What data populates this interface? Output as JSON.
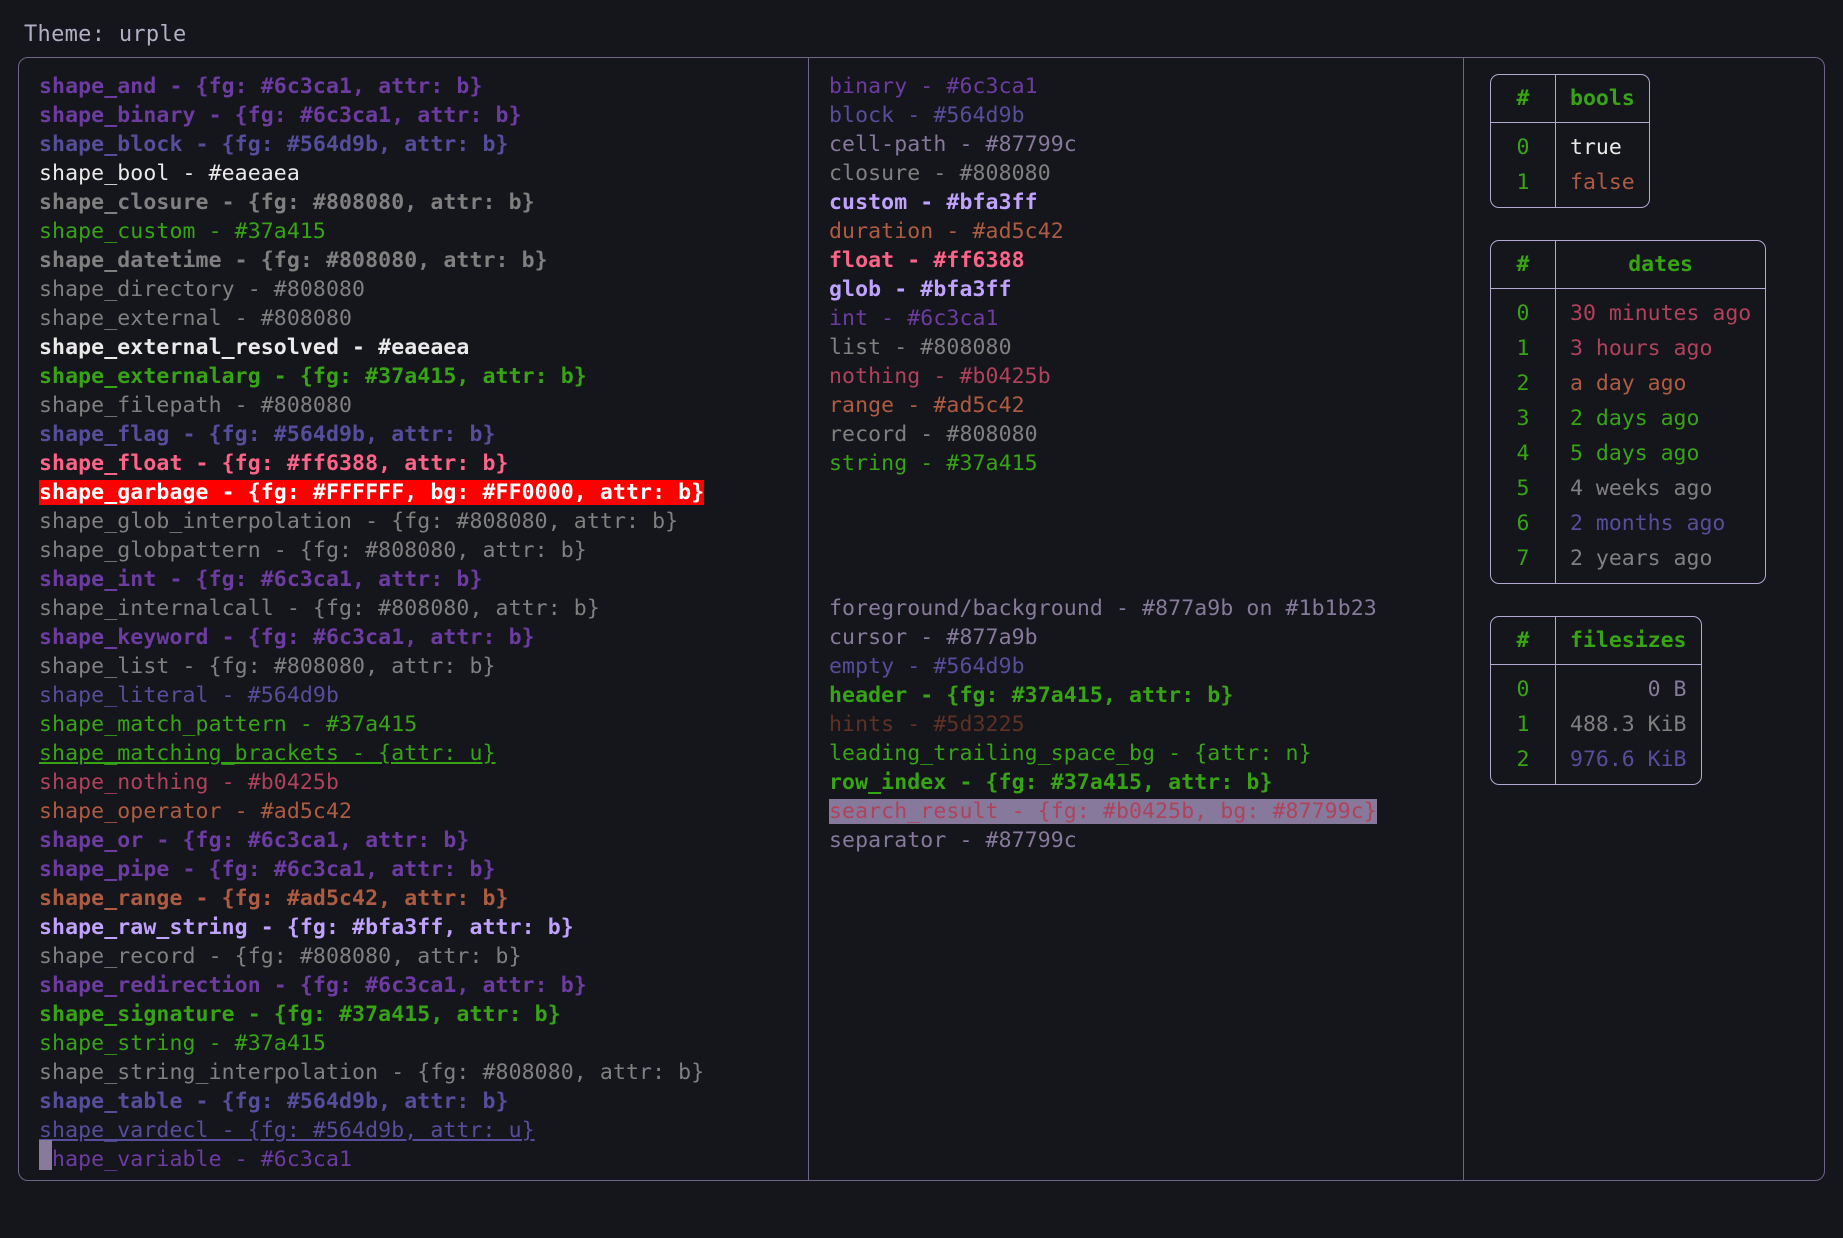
{
  "title": "Theme: urple",
  "palette": {
    "bg": "#15151c",
    "fg": "#877a9b",
    "purple": "#6c3ca1",
    "indigo": "#564d9b",
    "white": "#eaeaea",
    "gray": "#808080",
    "green": "#37a415",
    "pink": "#ff6388",
    "crimson": "#b0425b",
    "orange": "#ad5c42",
    "lavender": "#bfa3ff",
    "slate": "#87799c",
    "brown": "#5d3225",
    "red_bg": "#FF0000",
    "white_fg": "#FFFFFF",
    "border": "#6f6388",
    "table_border": "#b3a8d0"
  },
  "shapes": [
    {
      "text": "shape_and - {fg: #6c3ca1, attr: b}",
      "color": "#6c3ca1",
      "bold": true,
      "underline": false
    },
    {
      "text": "shape_binary - {fg: #6c3ca1, attr: b}",
      "color": "#6c3ca1",
      "bold": true,
      "underline": false
    },
    {
      "text": "shape_block - {fg: #564d9b, attr: b}",
      "color": "#564d9b",
      "bold": true,
      "underline": false
    },
    {
      "text": "shape_bool - #eaeaea",
      "color": "#eaeaea",
      "bold": false,
      "underline": false
    },
    {
      "text": "shape_closure - {fg: #808080, attr: b}",
      "color": "#808080",
      "bold": true,
      "underline": false
    },
    {
      "text": "shape_custom - #37a415",
      "color": "#37a415",
      "bold": false,
      "underline": false
    },
    {
      "text": "shape_datetime - {fg: #808080, attr: b}",
      "color": "#808080",
      "bold": true,
      "underline": false
    },
    {
      "text": "shape_directory - #808080",
      "color": "#808080",
      "bold": false,
      "underline": false
    },
    {
      "text": "shape_external - #808080",
      "color": "#808080",
      "bold": false,
      "underline": false
    },
    {
      "text": "shape_external_resolved - #eaeaea",
      "color": "#eaeaea",
      "bold": true,
      "underline": false
    },
    {
      "text": "shape_externalarg - {fg: #37a415, attr: b}",
      "color": "#37a415",
      "bold": true,
      "underline": false
    },
    {
      "text": "shape_filepath - #808080",
      "color": "#808080",
      "bold": false,
      "underline": false
    },
    {
      "text": "shape_flag - {fg: #564d9b, attr: b}",
      "color": "#564d9b",
      "bold": true,
      "underline": false
    },
    {
      "text": "shape_float - {fg: #ff6388, attr: b}",
      "color": "#ff6388",
      "bold": true,
      "underline": false
    },
    {
      "text": "shape_garbage - {fg: #FFFFFF, bg: #FF0000, attr: b}",
      "color": "#FFFFFF",
      "bg": "#FF0000",
      "bold": true,
      "underline": false,
      "highlight": "garbage"
    },
    {
      "text": "shape_glob_interpolation - {fg: #808080, attr: b}",
      "color": "#808080",
      "bold": false,
      "underline": false
    },
    {
      "text": "shape_globpattern - {fg: #808080, attr: b}",
      "color": "#808080",
      "bold": false,
      "underline": false
    },
    {
      "text": "shape_int - {fg: #6c3ca1, attr: b}",
      "color": "#6c3ca1",
      "bold": true,
      "underline": false
    },
    {
      "text": "shape_internalcall - {fg: #808080, attr: b}",
      "color": "#808080",
      "bold": false,
      "underline": false
    },
    {
      "text": "shape_keyword - {fg: #6c3ca1, attr: b}",
      "color": "#6c3ca1",
      "bold": true,
      "underline": false
    },
    {
      "text": "shape_list - {fg: #808080, attr: b}",
      "color": "#808080",
      "bold": false,
      "underline": false
    },
    {
      "text": "shape_literal - #564d9b",
      "color": "#564d9b",
      "bold": false,
      "underline": false
    },
    {
      "text": "shape_match_pattern - #37a415",
      "color": "#37a415",
      "bold": false,
      "underline": false
    },
    {
      "text": "shape_matching_brackets - {attr: u}",
      "color": "#37a415",
      "bold": false,
      "underline": true
    },
    {
      "text": "shape_nothing - #b0425b",
      "color": "#b0425b",
      "bold": false,
      "underline": false
    },
    {
      "text": "shape_operator - #ad5c42",
      "color": "#ad5c42",
      "bold": false,
      "underline": false
    },
    {
      "text": "shape_or - {fg: #6c3ca1, attr: b}",
      "color": "#6c3ca1",
      "bold": true,
      "underline": false
    },
    {
      "text": "shape_pipe - {fg: #6c3ca1, attr: b}",
      "color": "#6c3ca1",
      "bold": true,
      "underline": false
    },
    {
      "text": "shape_range - {fg: #ad5c42, attr: b}",
      "color": "#ad5c42",
      "bold": true,
      "underline": false
    },
    {
      "text": "shape_raw_string - {fg: #bfa3ff, attr: b}",
      "color": "#bfa3ff",
      "bold": true,
      "underline": false
    },
    {
      "text": "shape_record - {fg: #808080, attr: b}",
      "color": "#808080",
      "bold": false,
      "underline": false
    },
    {
      "text": "shape_redirection - {fg: #6c3ca1, attr: b}",
      "color": "#6c3ca1",
      "bold": true,
      "underline": false
    },
    {
      "text": "shape_signature - {fg: #37a415, attr: b}",
      "color": "#37a415",
      "bold": true,
      "underline": false
    },
    {
      "text": "shape_string - #37a415",
      "color": "#37a415",
      "bold": false,
      "underline": false
    },
    {
      "text": "shape_string_interpolation - {fg: #808080, attr: b}",
      "color": "#808080",
      "bold": false,
      "underline": false
    },
    {
      "text": "shape_table - {fg: #564d9b, attr: b}",
      "color": "#564d9b",
      "bold": true,
      "underline": false
    },
    {
      "text": "shape_vardecl - {fg: #564d9b, attr: u}",
      "color": "#564d9b",
      "bold": false,
      "underline": true
    },
    {
      "text": "shape_variable - #6c3ca1",
      "color": "#6c3ca1",
      "bold": false,
      "underline": false
    }
  ],
  "types": [
    {
      "text": "binary - #6c3ca1",
      "color": "#6c3ca1",
      "bold": false
    },
    {
      "text": "block - #564d9b",
      "color": "#564d9b",
      "bold": false
    },
    {
      "text": "cell-path - #87799c",
      "color": "#87799c",
      "bold": false
    },
    {
      "text": "closure - #808080",
      "color": "#808080",
      "bold": false
    },
    {
      "text": "custom - #bfa3ff",
      "color": "#bfa3ff",
      "bold": true
    },
    {
      "text": "duration - #ad5c42",
      "color": "#ad5c42",
      "bold": false
    },
    {
      "text": "float - #ff6388",
      "color": "#ff6388",
      "bold": true
    },
    {
      "text": "glob - #bfa3ff",
      "color": "#bfa3ff",
      "bold": true
    },
    {
      "text": "int - #6c3ca1",
      "color": "#6c3ca1",
      "bold": false
    },
    {
      "text": "list - #808080",
      "color": "#808080",
      "bold": false
    },
    {
      "text": "nothing - #b0425b",
      "color": "#b0425b",
      "bold": false
    },
    {
      "text": "range - #ad5c42",
      "color": "#ad5c42",
      "bold": false
    },
    {
      "text": "record - #808080",
      "color": "#808080",
      "bold": false
    },
    {
      "text": "string - #37a415",
      "color": "#37a415",
      "bold": false
    }
  ],
  "ui_elements": [
    {
      "text": "foreground/background - #877a9b on #1b1b23",
      "color": "#877a9b",
      "bold": false
    },
    {
      "text": "cursor - #877a9b",
      "color": "#877a9b",
      "bold": false
    },
    {
      "text": "empty - #564d9b",
      "color": "#564d9b",
      "bold": false
    },
    {
      "text": "header - {fg: #37a415, attr: b}",
      "color": "#37a415",
      "bold": true
    },
    {
      "text": "hints - #5d3225",
      "color": "#5d3225",
      "bold": false
    },
    {
      "text": "leading_trailing_space_bg - {attr: n}",
      "color": "#37a415",
      "bold": false
    },
    {
      "text": "row_index - {fg: #37a415, attr: b}",
      "color": "#37a415",
      "bold": true
    },
    {
      "text": "search_result - {fg: #b0425b, bg: #87799c}",
      "color": "#b0425b",
      "bg": "#87799c",
      "bold": false,
      "highlight": "search"
    },
    {
      "text": "separator - #87799c",
      "color": "#87799c",
      "bold": false
    }
  ],
  "tables": [
    {
      "name": "bools",
      "index_header": "#",
      "value_header": "bools",
      "align": "left",
      "rows": [
        {
          "index": "0",
          "value": "true",
          "color": "#eaeaea",
          "bold": false
        },
        {
          "index": "1",
          "value": "false",
          "color": "#ad5c42",
          "bold": false
        }
      ]
    },
    {
      "name": "dates",
      "index_header": "#",
      "value_header": "dates",
      "align": "left",
      "rows": [
        {
          "index": "0",
          "value": "30 minutes ago",
          "color": "#b0425b",
          "bold": true
        },
        {
          "index": "1",
          "value": "3 hours ago",
          "color": "#b0425b",
          "bold": false
        },
        {
          "index": "2",
          "value": "a day ago",
          "color": "#ad5c42",
          "bold": false
        },
        {
          "index": "3",
          "value": "2 days ago",
          "color": "#37a415",
          "bold": false
        },
        {
          "index": "4",
          "value": "5 days ago",
          "color": "#37a415",
          "bold": true
        },
        {
          "index": "5",
          "value": "4 weeks ago",
          "color": "#808080",
          "bold": false
        },
        {
          "index": "6",
          "value": "2 months ago",
          "color": "#564d9b",
          "bold": false
        },
        {
          "index": "7",
          "value": "2 years ago",
          "color": "#808080",
          "bold": false
        }
      ]
    },
    {
      "name": "filesizes",
      "index_header": "#",
      "value_header": "filesizes",
      "align": "right",
      "rows": [
        {
          "index": "0",
          "value": "0 B",
          "color": "#877a9b",
          "bold": false
        },
        {
          "index": "1",
          "value": "488.3 KiB",
          "color": "#808080",
          "bold": false
        },
        {
          "index": "2",
          "value": "976.6 KiB",
          "color": "#564d9b",
          "bold": false
        }
      ]
    }
  ]
}
